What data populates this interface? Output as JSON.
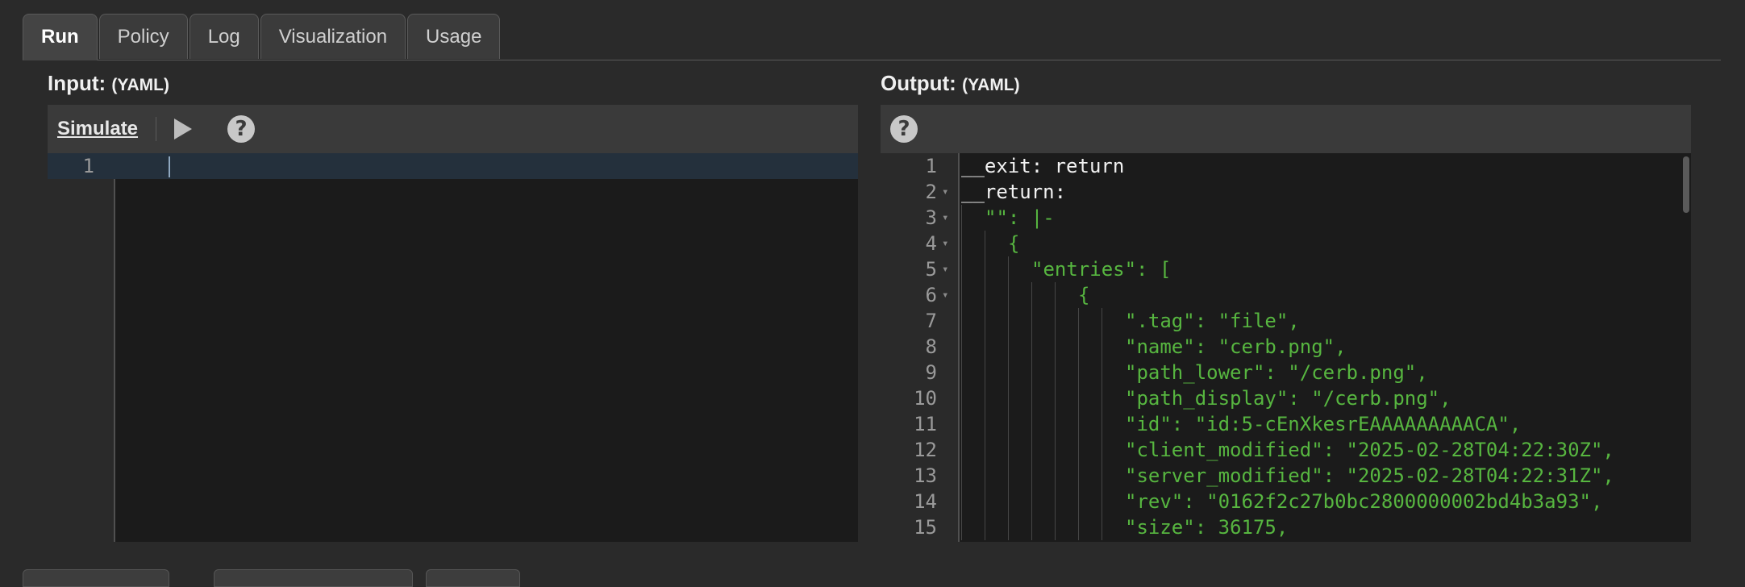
{
  "tabs": [
    {
      "label": "Run",
      "active": true
    },
    {
      "label": "Policy"
    },
    {
      "label": "Log"
    },
    {
      "label": "Visualization"
    },
    {
      "label": "Usage"
    }
  ],
  "input": {
    "title": "Input:",
    "format": "(YAML)",
    "toolbar": {
      "simulate_label": "Simulate",
      "play_icon": "play-icon",
      "help_icon": "help-icon",
      "help_glyph": "?"
    },
    "lines": [
      {
        "num": "1",
        "text": ""
      }
    ]
  },
  "output": {
    "title": "Output:",
    "format": "(YAML)",
    "toolbar": {
      "help_icon": "help-icon",
      "help_glyph": "?"
    },
    "lines": [
      {
        "num": "1",
        "fold": false,
        "indent": 0,
        "text": "__exit: return"
      },
      {
        "num": "2",
        "fold": true,
        "indent": 0,
        "text": "__return:"
      },
      {
        "num": "3",
        "fold": true,
        "indent": 1,
        "text": "\"\": |-"
      },
      {
        "num": "4",
        "fold": true,
        "indent": 2,
        "text": "{"
      },
      {
        "num": "5",
        "fold": true,
        "indent": 3,
        "text": "\"entries\": ["
      },
      {
        "num": "6",
        "fold": true,
        "indent": 5,
        "text": "{"
      },
      {
        "num": "7",
        "fold": false,
        "indent": 7,
        "text": "\".tag\": \"file\","
      },
      {
        "num": "8",
        "fold": false,
        "indent": 7,
        "text": "\"name\": \"cerb.png\","
      },
      {
        "num": "9",
        "fold": false,
        "indent": 7,
        "text": "\"path_lower\": \"/cerb.png\","
      },
      {
        "num": "10",
        "fold": false,
        "indent": 7,
        "text": "\"path_display\": \"/cerb.png\","
      },
      {
        "num": "11",
        "fold": false,
        "indent": 7,
        "text": "\"id\": \"id:5-cEnXkesrEAAAAAAAAACA\","
      },
      {
        "num": "12",
        "fold": false,
        "indent": 7,
        "text": "\"client_modified\": \"2025-02-28T04:22:30Z\","
      },
      {
        "num": "13",
        "fold": false,
        "indent": 7,
        "text": "\"server_modified\": \"2025-02-28T04:22:31Z\","
      },
      {
        "num": "14",
        "fold": false,
        "indent": 7,
        "text": "\"rev\": \"0162f2c27b0bc2800000002bd4b3a93\","
      },
      {
        "num": "15",
        "fold": false,
        "indent": 7,
        "text": "\"size\": 36175,"
      }
    ]
  },
  "colors": {
    "string": "#57b640",
    "text": "#f2f2f2",
    "background": "#1b1b1b",
    "active_line": "#24303c"
  }
}
